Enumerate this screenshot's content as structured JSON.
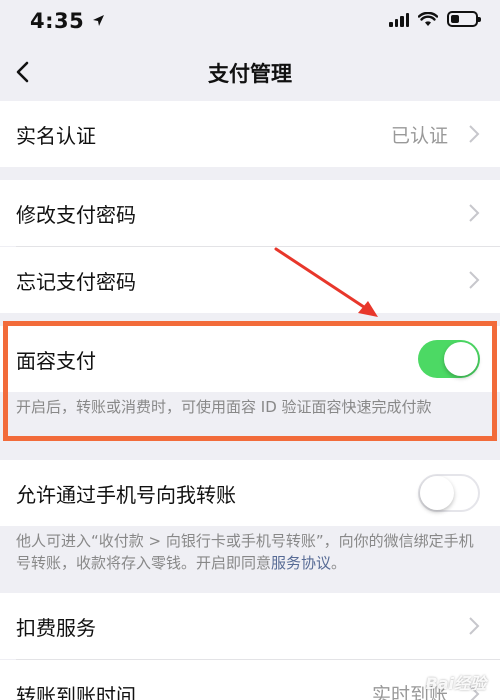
{
  "status_bar": {
    "time": "4:35"
  },
  "nav": {
    "title": "支付管理"
  },
  "rows": {
    "real_name": {
      "label": "实名认证",
      "value": "已认证"
    },
    "change_password": {
      "label": "修改支付密码"
    },
    "forgot_password": {
      "label": "忘记支付密码"
    },
    "face_pay": {
      "label": "面容支付",
      "enabled": true,
      "note": "开启后，转账或消费时，可使用面容 ID 验证面容快速完成付款"
    },
    "phone_transfer": {
      "label": "允许通过手机号向我转账",
      "enabled": false,
      "note_prefix": "他人可进入“收付款 > 向银行卡或手机号转账”，向你的微信绑定手机号转账，收款将存入零钱。开启即同意",
      "note_link": "服务协议",
      "note_suffix": "。"
    },
    "deduction": {
      "label": "扣费服务"
    },
    "arrival_time": {
      "label": "转账到账时间",
      "value": "实时到账"
    }
  },
  "watermark": "Bai经验",
  "colors": {
    "toggle_on": "#4cd964",
    "highlight": "#f26b3a",
    "arrow": "#e8372b",
    "link": "#576b95"
  }
}
